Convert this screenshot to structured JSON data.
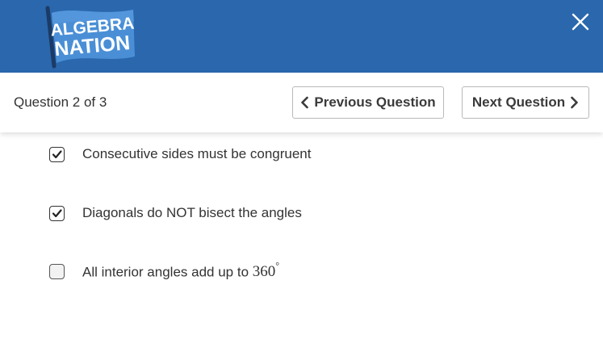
{
  "header": {
    "logo_line1": "ALGEBRA",
    "logo_line2": "NATION",
    "close_icon": "close-icon",
    "background": "#2a67ad"
  },
  "nav": {
    "question_counter": "Question 2 of 3",
    "previous_label": "Previous Question",
    "next_label": "Next Question"
  },
  "options": [
    {
      "label": "Consecutive sides must be congruent",
      "checked": true
    },
    {
      "label": "Diagonals do NOT bisect the angles",
      "checked": true
    },
    {
      "label": "All interior angles add up to ",
      "math_value": "360",
      "math_unit": "°",
      "checked": false
    }
  ]
}
